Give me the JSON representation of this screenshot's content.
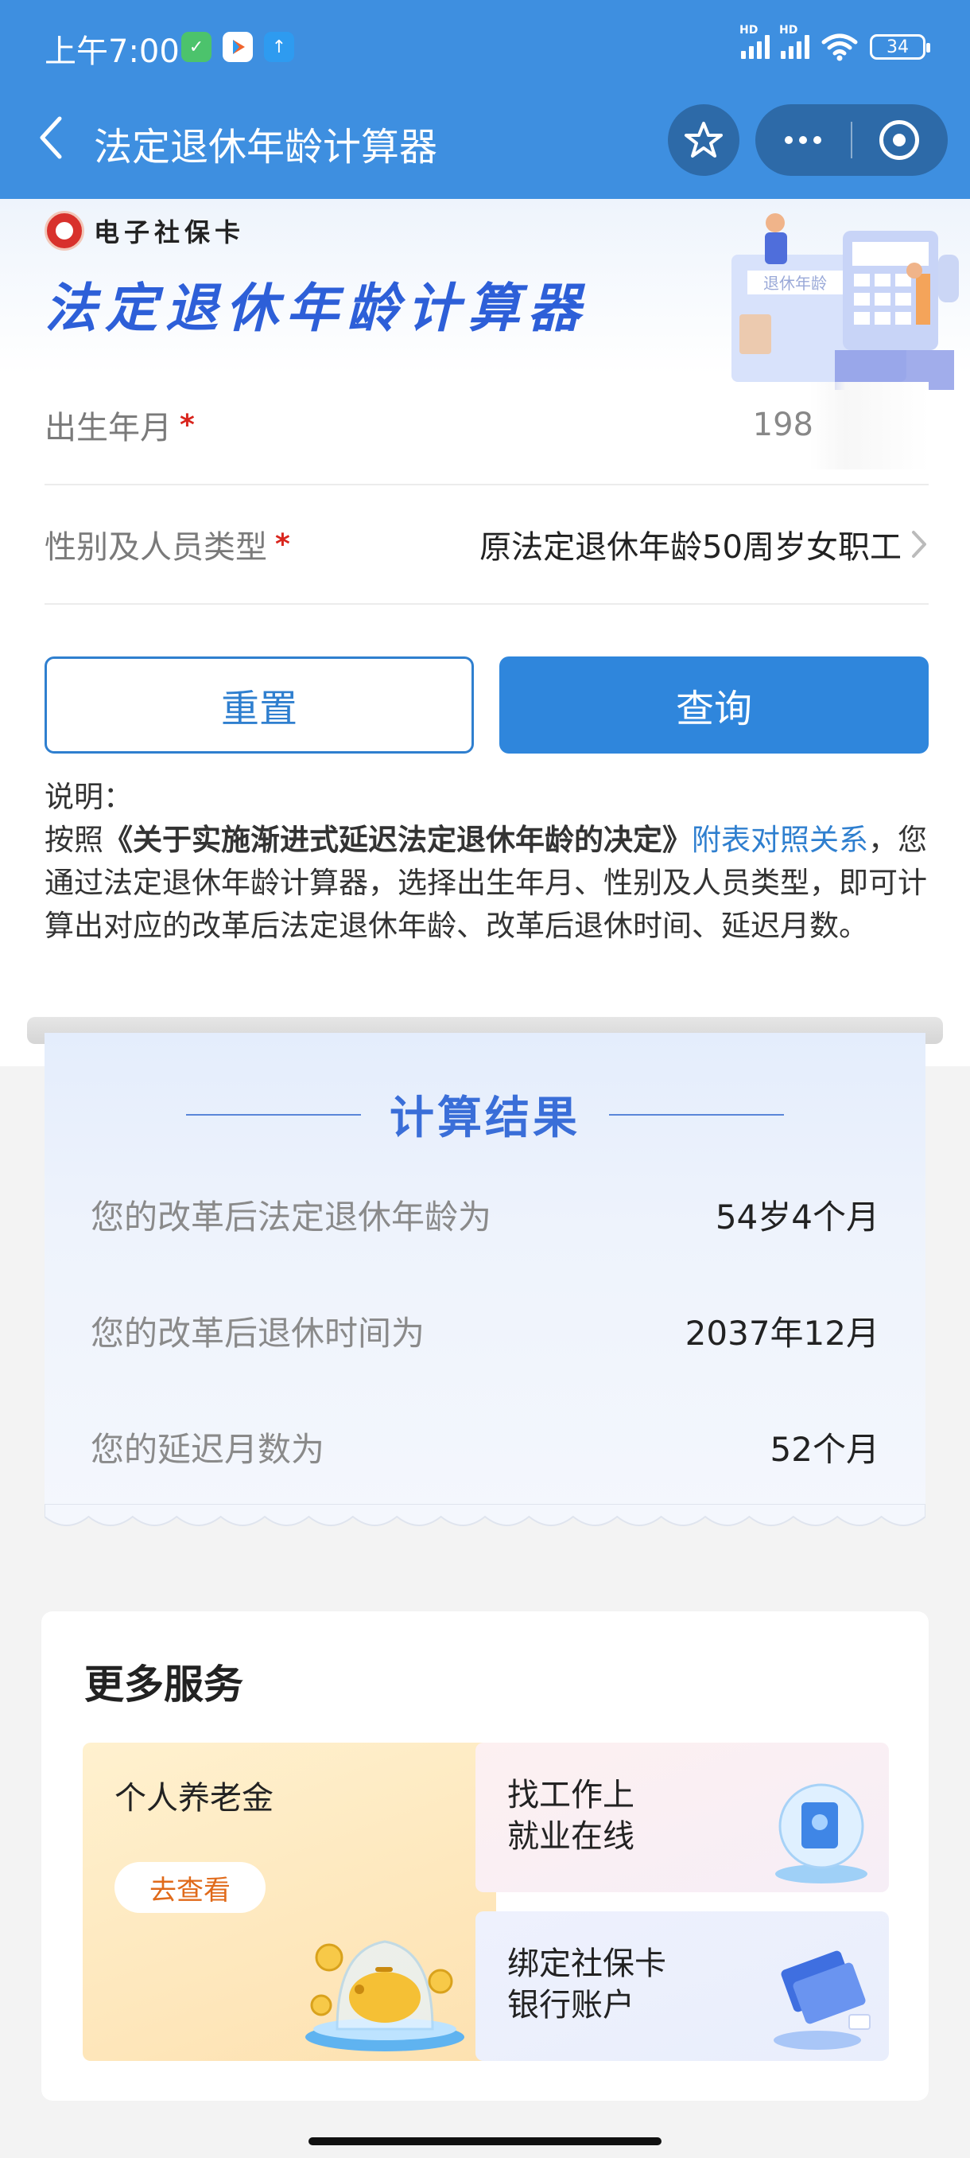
{
  "status": {
    "time": "上午7:00",
    "battery": "34"
  },
  "nav": {
    "title": "法定退休年龄计算器",
    "icons": [
      "back-icon",
      "star-icon",
      "more-icon",
      "target-icon"
    ]
  },
  "banner": {
    "brand": "电子社保卡",
    "title": "法定退休年龄计算器",
    "illustration_text": "退休年龄"
  },
  "form": {
    "birth": {
      "label": "出生年月",
      "required_mark": "*",
      "value": "198"
    },
    "gender": {
      "label": "性别及人员类型",
      "required_mark": "*",
      "value": "原法定退休年龄50周岁女职工"
    }
  },
  "buttons": {
    "reset": "重置",
    "query": "查询"
  },
  "note": {
    "heading": "说明：",
    "prefix": "按照",
    "doc": "《关于实施渐进式延迟法定退休年龄的决定》",
    "link": "附表对照关系",
    "suffix": "，您通过法定退休年龄计算器，选择出生年月、性别及人员类型，即可计算出对应的改革后法定退休年龄、改革后退休时间、延迟月数。"
  },
  "result": {
    "title": "计算结果",
    "rows": [
      {
        "label": "您的改革后法定退休年龄为",
        "value": "54岁4个月"
      },
      {
        "label": "您的改革后退休时间为",
        "value": "2037年12月"
      },
      {
        "label": "您的延迟月数为",
        "value": "52个月"
      }
    ]
  },
  "services": {
    "heading": "更多服务",
    "pension": {
      "title": "个人养老金",
      "action": "去查看"
    },
    "job": {
      "line1": "找工作上",
      "line2": "就业在线"
    },
    "bank": {
      "line1": "绑定社保卡",
      "line2": "银行账户"
    }
  },
  "colors": {
    "nav_bg": "#3e8fe0",
    "primary": "#2f86dc",
    "title_blue": "#2d5fd8",
    "required": "#d9251d"
  }
}
